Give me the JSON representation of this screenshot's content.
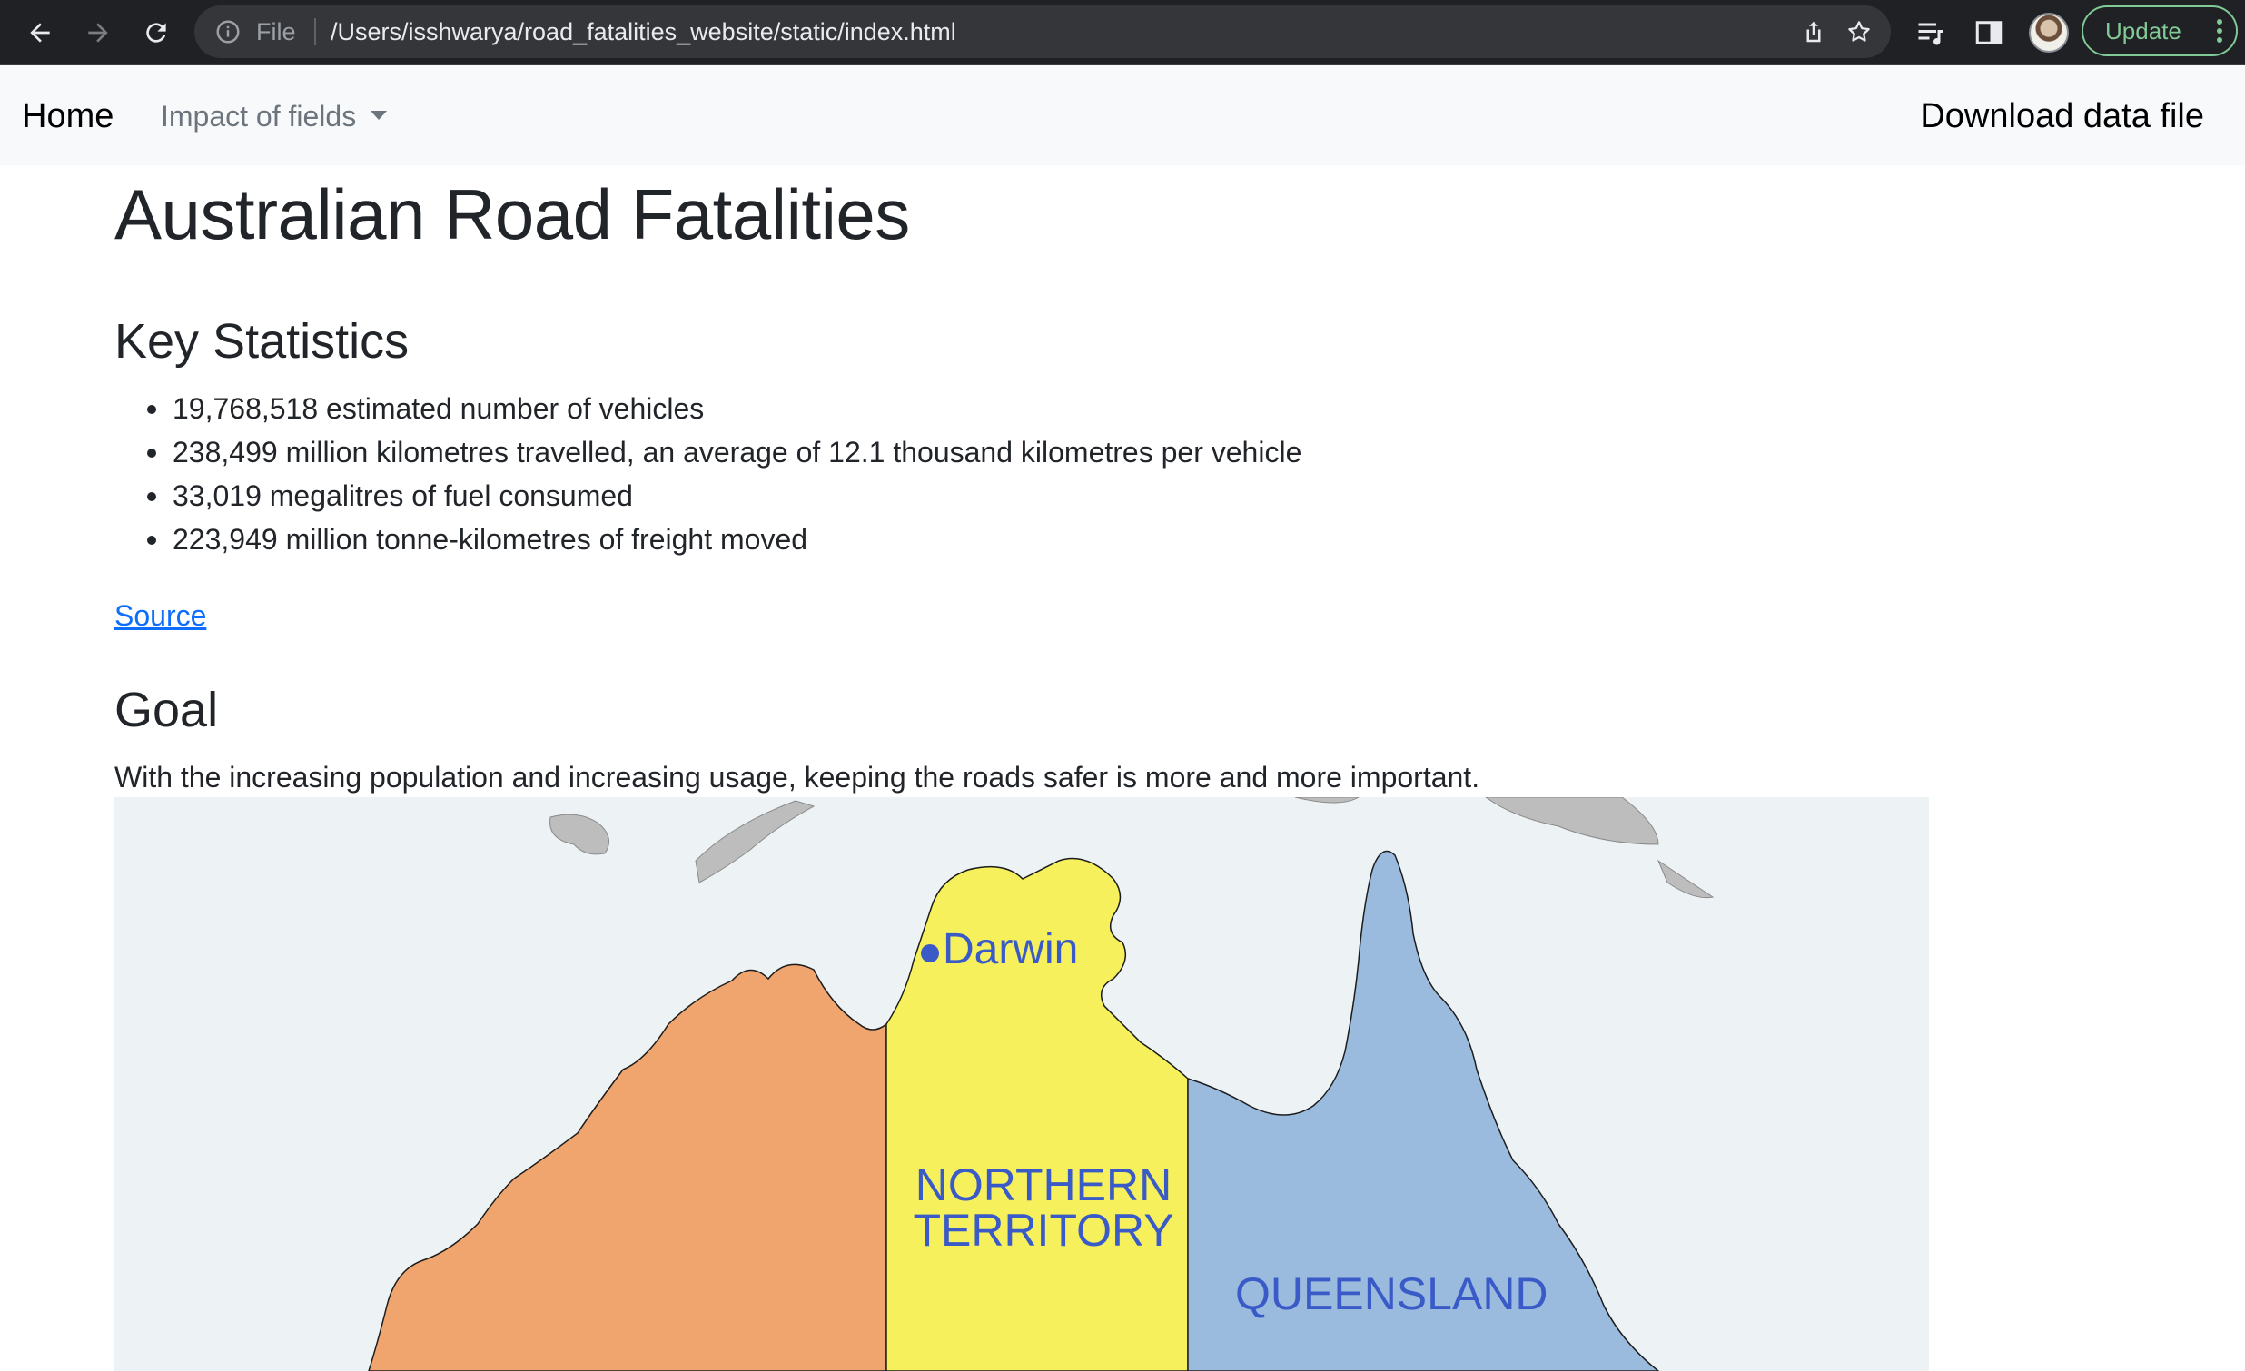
{
  "browser": {
    "scheme": "File",
    "url": "/Users/isshwarya/road_fatalities_website/static/index.html",
    "update_label": "Update",
    "update_color": "#81c995"
  },
  "navbar": {
    "home": "Home",
    "impact_dropdown": "Impact of fields",
    "download": "Download data file"
  },
  "page": {
    "title": "Australian Road Fatalities",
    "key_statistics": {
      "heading": "Key Statistics",
      "items": [
        "19,768,518 estimated number of vehicles",
        "238,499 million kilometres travelled, an average of 12.1 thousand kilometres per vehicle",
        "33,019 megalitres of fuel consumed",
        "223,949 million tonne-kilometres of freight moved"
      ]
    },
    "source_link": "Source",
    "goal": {
      "heading": "Goal",
      "text": "With the increasing population and increasing usage, keeping the roads safer is more and more important."
    },
    "map": {
      "city": "Darwin",
      "nt_line1": "NORTHERN",
      "nt_line2": "TERRITORY",
      "qld": "QUEENSLAND",
      "colors": {
        "sea": "#edf3f5",
        "western_australia": "#f0a46e",
        "northern_territory": "#f5f05c",
        "queensland": "#9abade",
        "islands": "#bdbdbd",
        "label": "#3a5bc7"
      }
    }
  }
}
